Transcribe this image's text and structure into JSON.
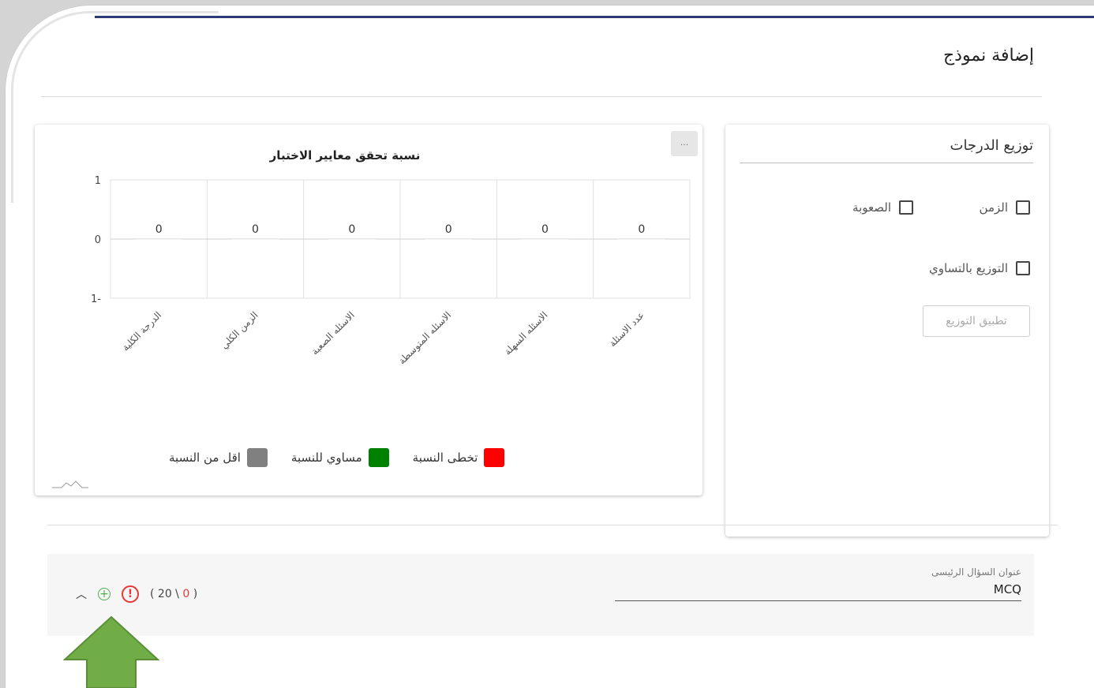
{
  "header": {
    "title": "إضافة نموذج"
  },
  "distribution": {
    "title": "توزيع الدرجات",
    "checkbox_time": "الزمن",
    "checkbox_difficulty": "الصعوبة",
    "checkbox_equal": "التوزيع بالتساوي",
    "apply_label": "تطبيق التوزيع"
  },
  "chart_menu_label": "...",
  "chart_data": {
    "type": "bar",
    "title": "نسبة تحقق معايير الاختبار",
    "categories": [
      "عدد الاسئلة",
      "الاسئله السهلة",
      "الاسئله المتوسطة",
      "الاسئله الصعبة",
      "الزمن الكلي",
      "الدرجة الكلية"
    ],
    "series": [
      {
        "name": "تخطى النسبة",
        "color": "#ff0000",
        "values": [
          0,
          0,
          0,
          0,
          0,
          0
        ]
      },
      {
        "name": "مساوي للنسبة",
        "color": "#008000",
        "values": [
          0,
          0,
          0,
          0,
          0,
          0
        ]
      },
      {
        "name": "اقل من النسبة",
        "color": "#808080",
        "values": [
          0,
          0,
          0,
          0,
          0,
          0
        ]
      }
    ],
    "data_labels": [
      "0",
      "0",
      "0",
      "0",
      "0",
      "0"
    ],
    "y_ticks": [
      "1",
      "0",
      "1-"
    ],
    "ylim": [
      -1,
      1
    ],
    "grid": true,
    "legend_position": "bottom"
  },
  "question": {
    "label": "عنوان السؤال الرئيسى",
    "value": "MCQ",
    "count_open": "( 20 \\ ",
    "count_red": "0",
    "count_close": " )"
  }
}
